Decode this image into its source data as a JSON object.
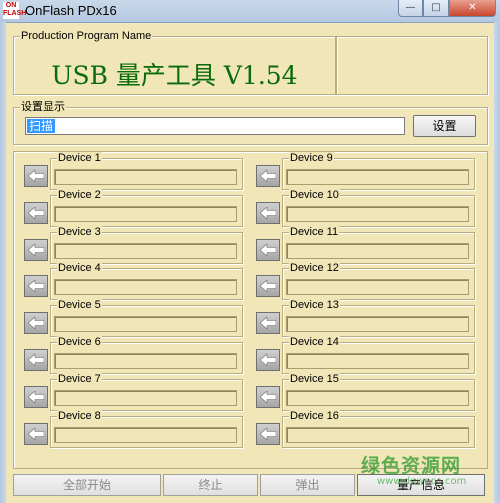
{
  "window": {
    "logo_text": "ONFLASH",
    "title": "OnFlash PDx16",
    "min_glyph": "—",
    "max_glyph": "□",
    "close_glyph": "✕"
  },
  "production": {
    "group_label": "Production Program Name",
    "title": "USB 量产工具 V1.54"
  },
  "settings": {
    "group_label": "设置显示",
    "value": "扫描",
    "button_label": "设置"
  },
  "devices": [
    {
      "label": "Device 1"
    },
    {
      "label": "Device 2"
    },
    {
      "label": "Device 3"
    },
    {
      "label": "Device 4"
    },
    {
      "label": "Device 5"
    },
    {
      "label": "Device 6"
    },
    {
      "label": "Device 7"
    },
    {
      "label": "Device 8"
    },
    {
      "label": "Device 9"
    },
    {
      "label": "Device 10"
    },
    {
      "label": "Device 11"
    },
    {
      "label": "Device 12"
    },
    {
      "label": "Device 13"
    },
    {
      "label": "Device 14"
    },
    {
      "label": "Device 15"
    },
    {
      "label": "Device 16"
    }
  ],
  "device_icon": "arrow-left-icon",
  "bottom_buttons": [
    {
      "label": "全部开始",
      "enabled": false
    },
    {
      "label": "终止",
      "enabled": false
    },
    {
      "label": "弹出",
      "enabled": false
    },
    {
      "label": "量产信息",
      "enabled": true
    }
  ],
  "watermark": {
    "text": "绿色资源网",
    "url": "www.downcc.com"
  },
  "colors": {
    "background": "#f0e6b8",
    "title_green": "#0a6b0a",
    "selection_blue": "#3399ff"
  }
}
